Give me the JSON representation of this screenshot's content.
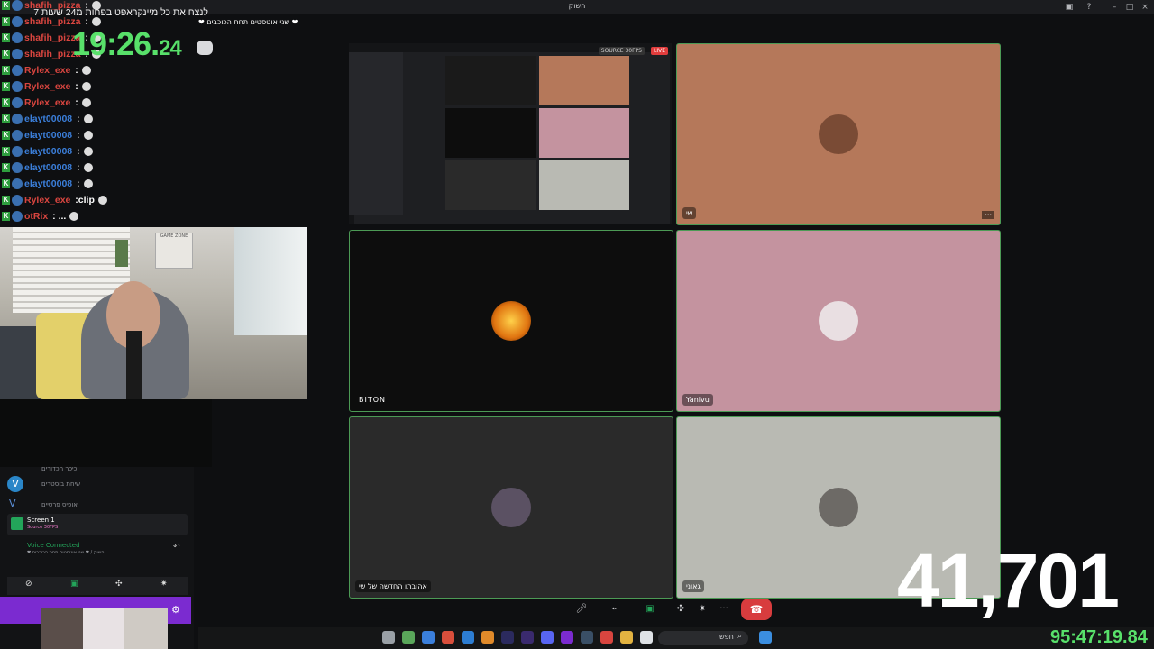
{
  "window": {
    "title": "השוק",
    "stage_title": "❤ שני אוטסטים תחת הכוכבים ❤"
  },
  "chat": [
    {
      "user": "shafih_pizza",
      "color": "#d8453f",
      "msg": ":"
    },
    {
      "user": "shafih_pizza",
      "color": "#d8453f",
      "msg": ":"
    },
    {
      "user": "shafih_pizza",
      "color": "#d8453f",
      "msg": ":"
    },
    {
      "user": "shafih_pizza",
      "color": "#d8453f",
      "msg": ":"
    },
    {
      "user": "Rylex_exe",
      "color": "#d8453f",
      "msg": ":"
    },
    {
      "user": "Rylex_exe",
      "color": "#d8453f",
      "msg": ":"
    },
    {
      "user": "Rylex_exe",
      "color": "#d8453f",
      "msg": ":"
    },
    {
      "user": "elayt00008",
      "color": "#3b7fdb",
      "msg": ":"
    },
    {
      "user": "elayt00008",
      "color": "#3b7fdb",
      "msg": ":"
    },
    {
      "user": "elayt00008",
      "color": "#3b7fdb",
      "msg": ":"
    },
    {
      "user": "elayt00008",
      "color": "#3b7fdb",
      "msg": ":"
    },
    {
      "user": "elayt00008",
      "color": "#3b7fdb",
      "msg": ":"
    },
    {
      "user": "Rylex_exe",
      "color": "#d8453f",
      "msg": ":clip"
    },
    {
      "user": "otRix",
      "color": "#d8453f",
      "msg": ": ..."
    }
  ],
  "speedrun": {
    "title": "לנצח את כל מיינקראפט בפחות מ24 שעות",
    "index": "7",
    "timer_main": "19:26.",
    "timer_ms": "24"
  },
  "discord": {
    "channels": [
      "כיכר הכדורים",
      "שיחת בוסטרים",
      "אופיס פרטיים"
    ],
    "screen_label": "Screen 1",
    "screen_sub": "Source 30FPS",
    "voice_status": "Voice Connected",
    "voice_channel": "❤ השוק / ❤ שני אוטסטים תחת הכוכבים"
  },
  "stage": {
    "source_badge": "SOURCE 30FPS",
    "live_badge": "LIVE",
    "tiles": [
      {
        "label": "שי",
        "bg": "#b5785a"
      },
      {
        "label": "BITON",
        "bg": "#0d0d0d"
      },
      {
        "label": "Yanivu",
        "bg": "#c4939f"
      },
      {
        "label": "אהובתו החדשה של שי",
        "bg": "#2a2a2a"
      },
      {
        "label": "גאוני",
        "bg": "#b9bab3"
      }
    ]
  },
  "counters": {
    "viewers": "41,701",
    "clock": "95:47:19.84"
  },
  "taskbar": {
    "search": "חפש"
  }
}
